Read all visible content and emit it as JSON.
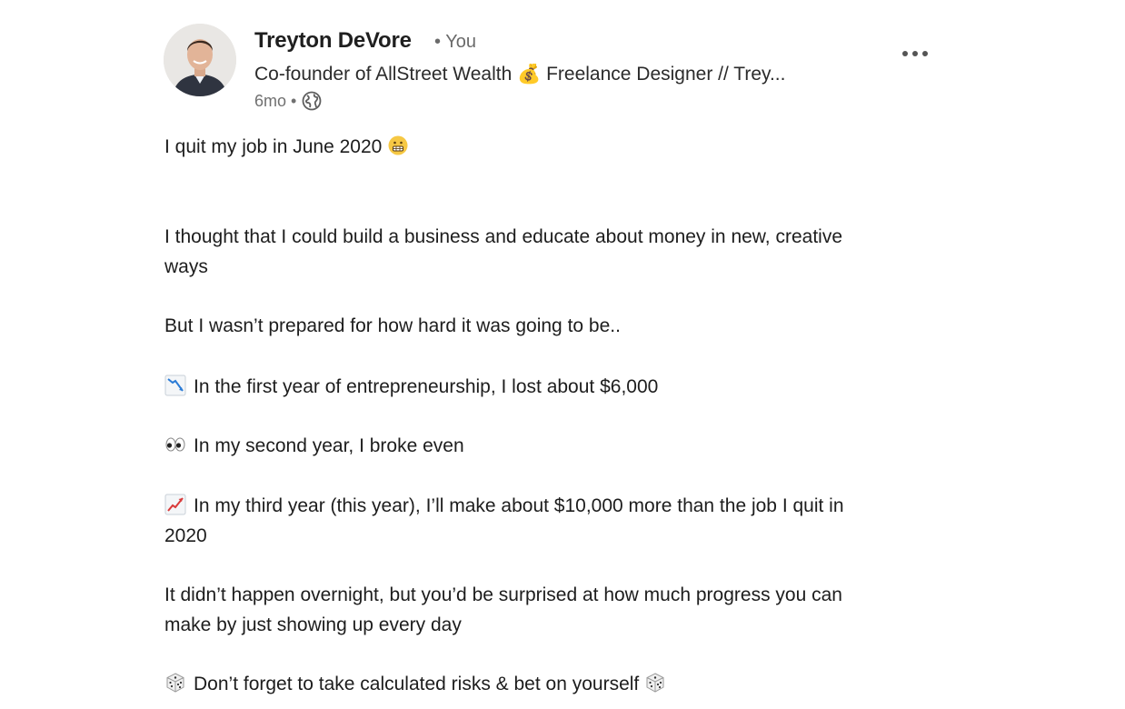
{
  "author": {
    "name": "Treyton DeVore",
    "relation": "• You",
    "headline": "Co-founder of AllStreet Wealth 💰 Freelance Designer // Trey...",
    "time": "6mo •"
  },
  "icons": {
    "avatar": "profile-photo",
    "visibility": "globe-icon",
    "menu": "more-options-icon",
    "grimace": "grimacing-face-emoji",
    "down": "chart-decreasing-emoji",
    "eyes": "eyes-emoji",
    "up": "chart-increasing-emoji",
    "dice": "game-die-emoji"
  },
  "post": {
    "line1": "I quit my job in June 2020",
    "line2a": "I thought that I could build a business and educate about money in new, creative",
    "line2b": "ways",
    "line3": "But I wasn’t prepared for how hard it was going to be..",
    "line4": "In the first year of entrepreneurship, I lost about $6,000",
    "line5": "In my second year, I broke even",
    "line6a": "In my third year (this year), I’ll make about $10,000 more than the job I quit in",
    "line6b": "2020",
    "line7a": "It didn’t happen overnight, but you’d be surprised at how much progress you can",
    "line7b": "make by just showing up every day",
    "line8": "Don’t forget to take calculated risks & bet on yourself"
  }
}
